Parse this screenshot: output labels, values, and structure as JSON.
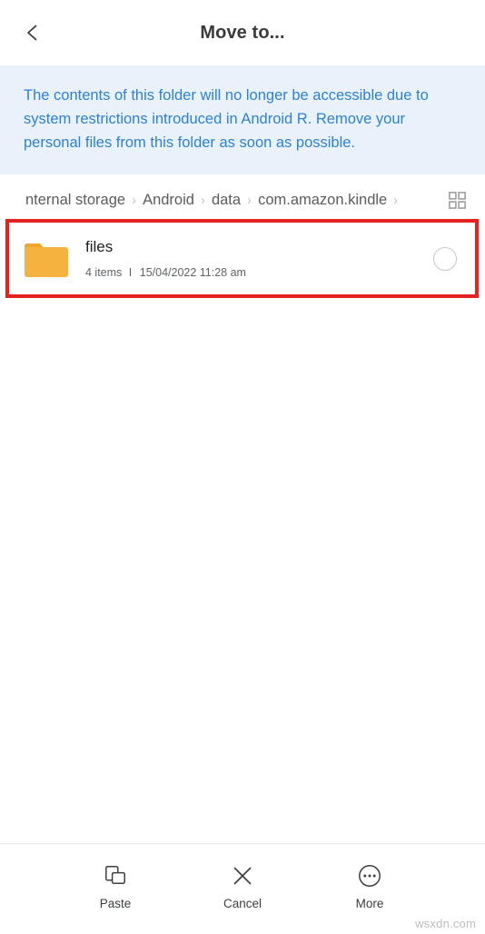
{
  "appbar": {
    "back_icon": "chevron-left-icon",
    "title": "Move to..."
  },
  "notice": {
    "text": "The contents of this folder will no longer be accessible due to system restrictions introduced in Android R. Remove your personal files from this folder as soon as possible.",
    "background_color": "#e9f2fb",
    "text_color": "#2f80d4"
  },
  "breadcrumb": {
    "separator": "›",
    "items": [
      {
        "label": "nternal storage"
      },
      {
        "label": "Android"
      },
      {
        "label": "data"
      },
      {
        "label": "com.amazon.kindle"
      }
    ],
    "trailing_separator": "›",
    "grid_toggle_icon": "grid-view-icon"
  },
  "file_list": {
    "highlight_color": "#e42320",
    "rows": [
      {
        "icon": "folder-icon",
        "icon_color": "#f5b23e",
        "name": "files",
        "item_count": "4 items",
        "meta_separator": "I",
        "modified": "15/04/2022 11:28 am",
        "selected": false,
        "select_control": "radio-circle"
      }
    ]
  },
  "bottom_bar": {
    "actions": [
      {
        "icon": "paste-icon",
        "label": "Paste"
      },
      {
        "icon": "close-x-icon",
        "label": "Cancel"
      },
      {
        "icon": "more-ellipsis-icon",
        "label": "More"
      }
    ]
  },
  "watermark": {
    "text": "wsxdn.com"
  }
}
